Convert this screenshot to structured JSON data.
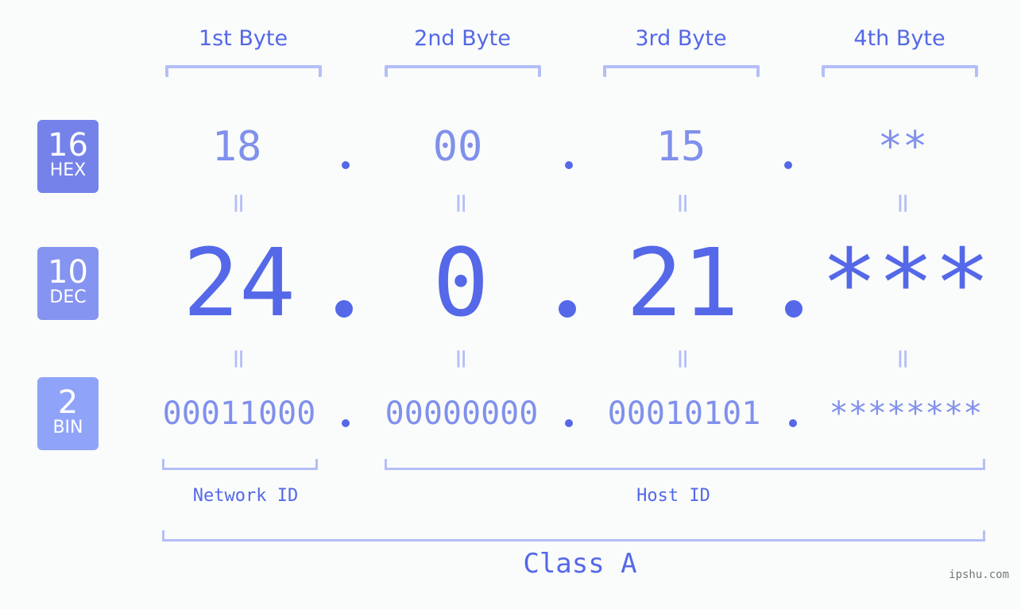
{
  "bytes": {
    "headers": [
      "1st Byte",
      "2nd Byte",
      "3rd Byte",
      "4th Byte"
    ]
  },
  "badges": {
    "hex": {
      "num": "16",
      "label": "HEX",
      "color": "#7482ea"
    },
    "dec": {
      "num": "10",
      "label": "DEC",
      "color": "#8594f0"
    },
    "bin": {
      "num": "2",
      "label": "BIN",
      "color": "#8fa4f8"
    }
  },
  "values": {
    "hex": [
      "18",
      "00",
      "15",
      "**"
    ],
    "dec": [
      "24",
      "0",
      "21",
      "***"
    ],
    "bin": [
      "00011000",
      "00000000",
      "00010101",
      "********"
    ]
  },
  "equals_sign": "=",
  "ids": {
    "network": "Network ID",
    "host": "Host ID"
  },
  "class_label": "Class A",
  "watermark": "ipshu.com",
  "colors": {
    "primary": "#5468e8",
    "secondary": "#8090ec",
    "bracket": "#b4bef8",
    "background": "#fafcfb"
  }
}
